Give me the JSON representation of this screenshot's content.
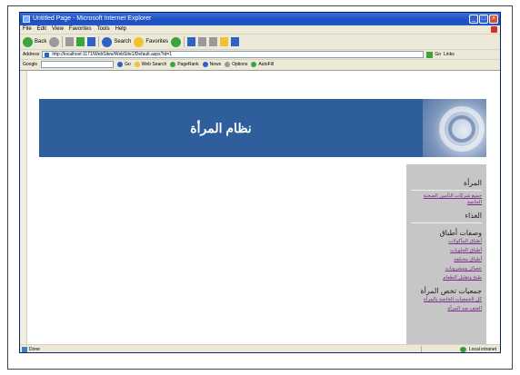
{
  "window": {
    "title": "Untitled Page - Microsoft Internet Explorer"
  },
  "menu": [
    "File",
    "Edit",
    "View",
    "Favorites",
    "Tools",
    "Help"
  ],
  "toolbar": {
    "back_label": "Back",
    "search_label": "Search",
    "favorites_label": "Favorites"
  },
  "address": {
    "label": "Address",
    "url": "http://localhost:1171/WebSites/WebSite1/Default.aspx?id=1",
    "go_label": "Go",
    "links_label": "Links"
  },
  "googlebar": {
    "label": "Google",
    "search_label": "Go",
    "items": [
      "Web Search",
      "PageRank",
      "News",
      "Options",
      "AutoFill"
    ]
  },
  "banner": {
    "title": "نظام المرأة"
  },
  "sidebar": {
    "section1_heading": "المرأة",
    "section1_links": [
      "جميع شركات التأمين الصحية الخاصة"
    ],
    "section2_heading": "الغذاء",
    "section3_heading": "وصفات أطباق",
    "section3_links": [
      "أطباق المأكولات",
      "أطباق الحلويات",
      "أطباق مختلفة",
      "عصائر ومشروبات",
      "طبخ وتقليل الطعام"
    ],
    "section4_heading": "جمعيات تخص المرأة",
    "section4_links": [
      "كل الجمعيات الخاصة بالمرأة",
      "العنف ضد المرأة"
    ]
  },
  "status": {
    "left": "Done",
    "zone": "Local intranet"
  },
  "colors": {
    "banner": "#2e5e9c",
    "sidebar": "#c6c6c6",
    "link": "#7a2b8c",
    "titlebar": "#1c4fc7"
  }
}
